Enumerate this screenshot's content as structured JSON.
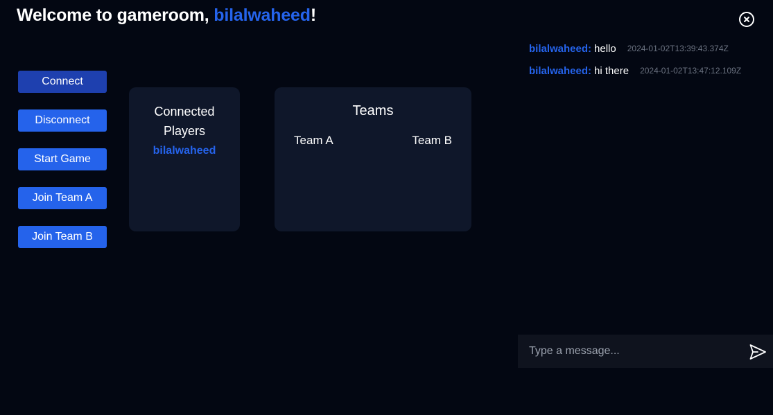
{
  "header": {
    "welcome_prefix": "Welcome to gameroom, ",
    "username": "bilalwaheed",
    "welcome_suffix": "!",
    "close_icon": "close-circle-icon"
  },
  "actions": {
    "connect": "Connect",
    "disconnect": "Disconnect",
    "start_game": "Start Game",
    "join_team_a": "Join Team A",
    "join_team_b": "Join Team B"
  },
  "players_panel": {
    "title": "Connected Players",
    "players": [
      "bilalwaheed"
    ]
  },
  "teams_panel": {
    "title": "Teams",
    "team_a": "Team A",
    "team_b": "Team B"
  },
  "chat": {
    "messages": [
      {
        "from": "bilalwaheed:",
        "text": "hello",
        "time": "2024-01-02T13:39:43.374Z"
      },
      {
        "from": "bilalwaheed:",
        "text": "hi there",
        "time": "2024-01-02T13:47:12.109Z"
      }
    ],
    "input_placeholder": "Type a message...",
    "input_value": "",
    "send_icon": "send-icon"
  },
  "colors": {
    "background": "#030712",
    "panel": "#0f172a",
    "accent": "#2563eb",
    "timestamp": "#6b7280"
  }
}
